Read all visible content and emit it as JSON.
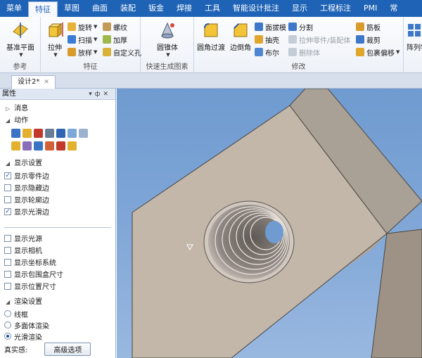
{
  "menubar": {
    "items": [
      "菜单",
      "特征",
      "草图",
      "曲面",
      "装配",
      "钣金",
      "焊接",
      "工具",
      "智能设计批注",
      "显示",
      "工程标注",
      "PMI",
      "常"
    ],
    "active_index": 1
  },
  "ribbon": {
    "groups": {
      "reference": {
        "label": "参考",
        "datum_plane": "基准平面"
      },
      "features": {
        "label": "特征",
        "extrude": "拉伸",
        "revolve": "旋转",
        "sweep": "扫描",
        "loft": "放样",
        "thread": "螺纹",
        "thicken": "加厚",
        "custom_hole": "自定义孔"
      },
      "quick": {
        "label": "快速生成图素",
        "cone": "圆锥体"
      },
      "modify": {
        "label": "修改",
        "fillet": "圆角过渡",
        "chamfer": "边倒角",
        "draft": "面拔模",
        "shell": "抽壳",
        "boolean": "布尔",
        "split": "分割",
        "stretch_part": "拉伸零件/装配体",
        "delete_body": "删除体",
        "rib": "筋板",
        "trim": "裁剪",
        "wrap_offset": "包裹偏移",
        "array": "阵列特"
      }
    }
  },
  "tabs": {
    "document": "设计2*"
  },
  "panel": {
    "title": "属性",
    "messages": "消息",
    "actions": "动作",
    "display_settings": "显示设置",
    "display_options": [
      {
        "label": "显示零件边",
        "checked": true
      },
      {
        "label": "显示隐藏边",
        "checked": false
      },
      {
        "label": "显示轮廓边",
        "checked": false
      },
      {
        "label": "显示光滑边",
        "checked": true
      }
    ],
    "scene_options": [
      {
        "label": "显示光源",
        "checked": false
      },
      {
        "label": "显示相机",
        "checked": false
      },
      {
        "label": "显示坐标系统",
        "checked": false
      },
      {
        "label": "显示包围盒尺寸",
        "checked": false
      },
      {
        "label": "显示位置尺寸",
        "checked": false
      }
    ],
    "render_settings": "渲染设置",
    "render_modes": [
      {
        "label": "线框",
        "selected": false
      },
      {
        "label": "多面体渲染",
        "selected": false
      },
      {
        "label": "光滑渲染",
        "selected": true
      }
    ],
    "realism_label": "真实感:",
    "advanced_button": "高级选项"
  },
  "colors": {
    "menubar": "#1e63b6",
    "viewport_top": "#6f9bd0",
    "part_front": "#c3b7aa",
    "part_top": "#b0a496",
    "part_side": "#9e9286"
  }
}
